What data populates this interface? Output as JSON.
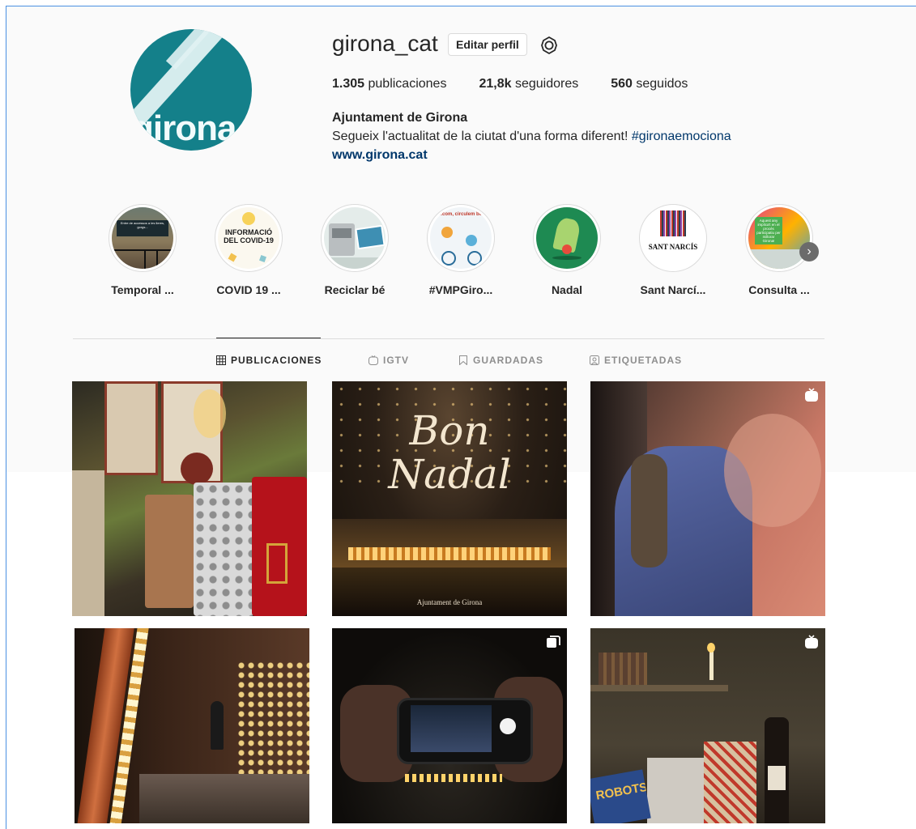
{
  "profile": {
    "username": "girona_cat",
    "edit_label": "Editar perfil",
    "avatar_text": "girona",
    "stats": {
      "posts_count": "1.305",
      "posts_label": " publicaciones",
      "followers_count": "21,8k",
      "followers_label": " seguidores",
      "following_count": "560",
      "following_label": " seguidos"
    },
    "full_name": "Ajuntament de Girona",
    "bio_text": "Segueix l'actualitat de la ciutat d'una forma diferent! ",
    "bio_hashtag": "#gironaemociona",
    "website": "www.girona.cat"
  },
  "highlights": [
    {
      "label": "Temporal ...",
      "pic_text": "Entre de accessos a les lleres, gorgs..."
    },
    {
      "label": "COVID 19 ...",
      "pic_text": "INFORMACIÓ DEL COVID-19"
    },
    {
      "label": "Reciclar bé",
      "pic_text": ""
    },
    {
      "label": "#VMPGiro...",
      "pic_text": "...com, circulem bé!"
    },
    {
      "label": "Nadal",
      "pic_text": ""
    },
    {
      "label": "Sant Narcí...",
      "pic_text": "SANT NARCÍS"
    },
    {
      "label": "Consulta ...",
      "pic_text": "Aquest any implica't en el procés participatiu per millorar Girona!"
    }
  ],
  "tabs": [
    {
      "label": "PUBLICACIONES",
      "icon": "grid-icon"
    },
    {
      "label": "IGTV",
      "icon": "igtv-icon"
    },
    {
      "label": "GUARDADAS",
      "icon": "bookmark-icon"
    },
    {
      "label": "ETIQUETADAS",
      "icon": "tag-icon"
    }
  ],
  "posts": [
    {
      "icon": "",
      "text": ""
    },
    {
      "icon": "",
      "text": "Bon Nadal",
      "line1": "Bon",
      "line2": "Nadal",
      "caption": "Ajuntament de Girona"
    },
    {
      "icon": "igtv-icon",
      "text": ""
    },
    {
      "icon": "",
      "text": ""
    },
    {
      "icon": "carousel-icon",
      "text": ""
    },
    {
      "icon": "igtv-icon",
      "text": "ROBOTS"
    }
  ]
}
